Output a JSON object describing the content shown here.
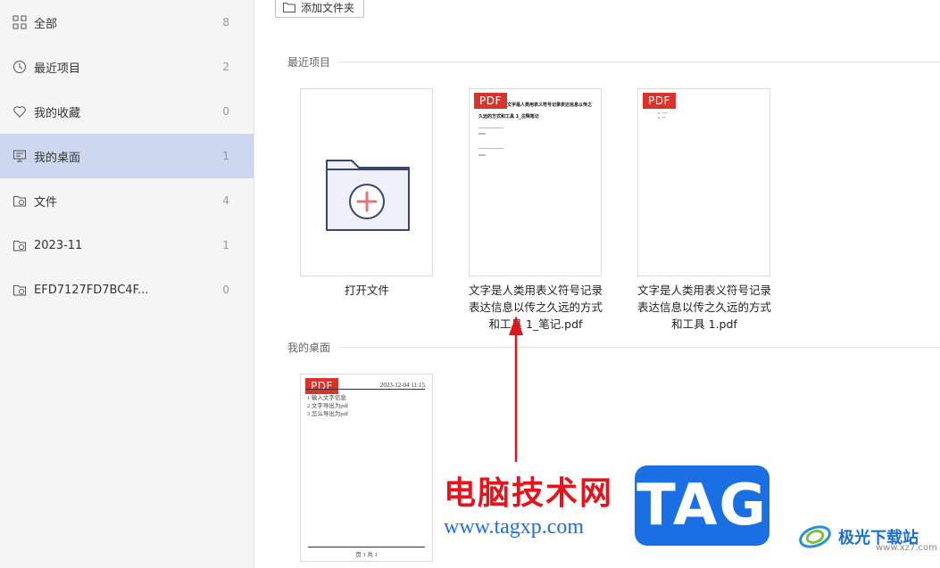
{
  "sidebar": {
    "items": [
      {
        "label": "全部",
        "count": "8",
        "icon": "grid-icon"
      },
      {
        "label": "最近项目",
        "count": "2",
        "icon": "clock-icon"
      },
      {
        "label": "我的收藏",
        "count": "0",
        "icon": "heart-icon"
      },
      {
        "label": "我的桌面",
        "count": "1",
        "icon": "desktop-icon",
        "active": true
      },
      {
        "label": "文件",
        "count": "4",
        "icon": "folder-clock-icon"
      },
      {
        "label": "2023-11",
        "count": "1",
        "icon": "folder-clock-icon"
      },
      {
        "label": "EFD7127FD7BC4F...",
        "count": "0",
        "icon": "folder-clock-icon"
      }
    ]
  },
  "toolbar": {
    "add_folder_label": "添加文件夹"
  },
  "recent": {
    "title": "最近项目",
    "cards": [
      {
        "label": "打开文件"
      },
      {
        "label": "文字是人类用表义符号记录表达信息以传之久远的方式和工具 1_笔记.pdf",
        "tag": "PDF",
        "preview_title": "文字是人类用表义符号记录表达信息以传之久远的方式和工具 1_注释笔记"
      },
      {
        "label": "文字是人类用表义符号记录表达信息以传之久远的方式和工具 1.pdf",
        "tag": "PDF"
      }
    ]
  },
  "desktop": {
    "title": "我的桌面",
    "cards": [
      {
        "tag": "PDF",
        "preview_date": "2023-12-04 11:15",
        "preview_lines": [
          "1  输入文字信息",
          "2  文字导出为pdf",
          "3  怎么导出为pdf"
        ],
        "preview_footer": "页 1 共 1"
      }
    ]
  },
  "watermark": {
    "cn": "电脑技术网",
    "url": "www.tagxp.com",
    "tag": "TAG",
    "logo_text": "极光下载站",
    "logo_url": "www.xz7.com"
  },
  "colors": {
    "accent_red": "#d9342b",
    "sidebar_active": "#cdd8f0",
    "arrow": "#e3141b",
    "tag_blue": "#1a6fe3"
  }
}
